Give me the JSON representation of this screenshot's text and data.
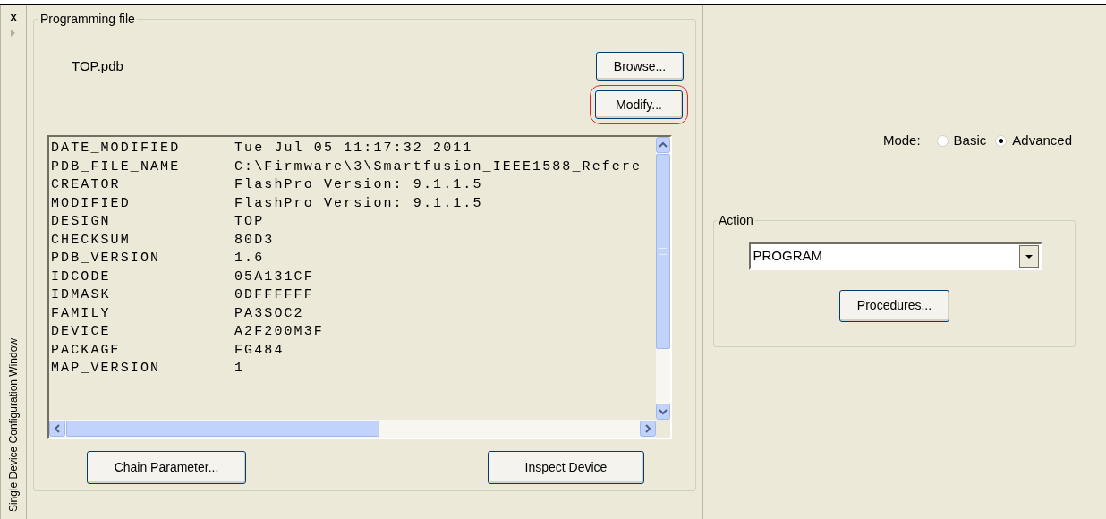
{
  "side_panel": {
    "close": "x",
    "title": "Single Device Configuration Window"
  },
  "programming_file": {
    "title": "Programming file",
    "file_name": "TOP.pdb",
    "buttons": [
      {
        "label": "Browse...",
        "highlighted": false
      },
      {
        "label": "Modify...",
        "highlighted": true
      }
    ],
    "properties": [
      {
        "name": "DATE_MODIFIED",
        "value": "Tue Jul 05 11:17:32 2011"
      },
      {
        "name": "PDB_FILE_NAME",
        "value": "C:\\Firmware\\3\\Smartfusion_IEEE1588_Refere"
      },
      {
        "name": "CREATOR",
        "value": "FlashPro Version: 9.1.1.5"
      },
      {
        "name": "MODIFIED",
        "value": "FlashPro Version: 9.1.1.5"
      },
      {
        "name": "DESIGN",
        "value": "TOP"
      },
      {
        "name": "CHECKSUM",
        "value": "80D3"
      },
      {
        "name": "PDB_VERSION",
        "value": "1.6"
      },
      {
        "name": "IDCODE",
        "value": "05A131CF"
      },
      {
        "name": "IDMASK",
        "value": "0DFFFFFF"
      },
      {
        "name": "FAMILY",
        "value": "PA3SOC2"
      },
      {
        "name": "DEVICE",
        "value": "A2F200M3F"
      },
      {
        "name": "PACKAGE",
        "value": "FG484"
      },
      {
        "name": "MAP_VERSION",
        "value": "1"
      }
    ],
    "bottom_buttons": [
      "Chain Parameter...",
      "Inspect Device"
    ]
  },
  "mode": {
    "label": "Mode:",
    "options": [
      {
        "label": "Basic",
        "selected": false
      },
      {
        "label": "Advanced",
        "selected": true
      }
    ]
  },
  "action": {
    "title": "Action",
    "value": "PROGRAM",
    "button": "Procedures..."
  }
}
